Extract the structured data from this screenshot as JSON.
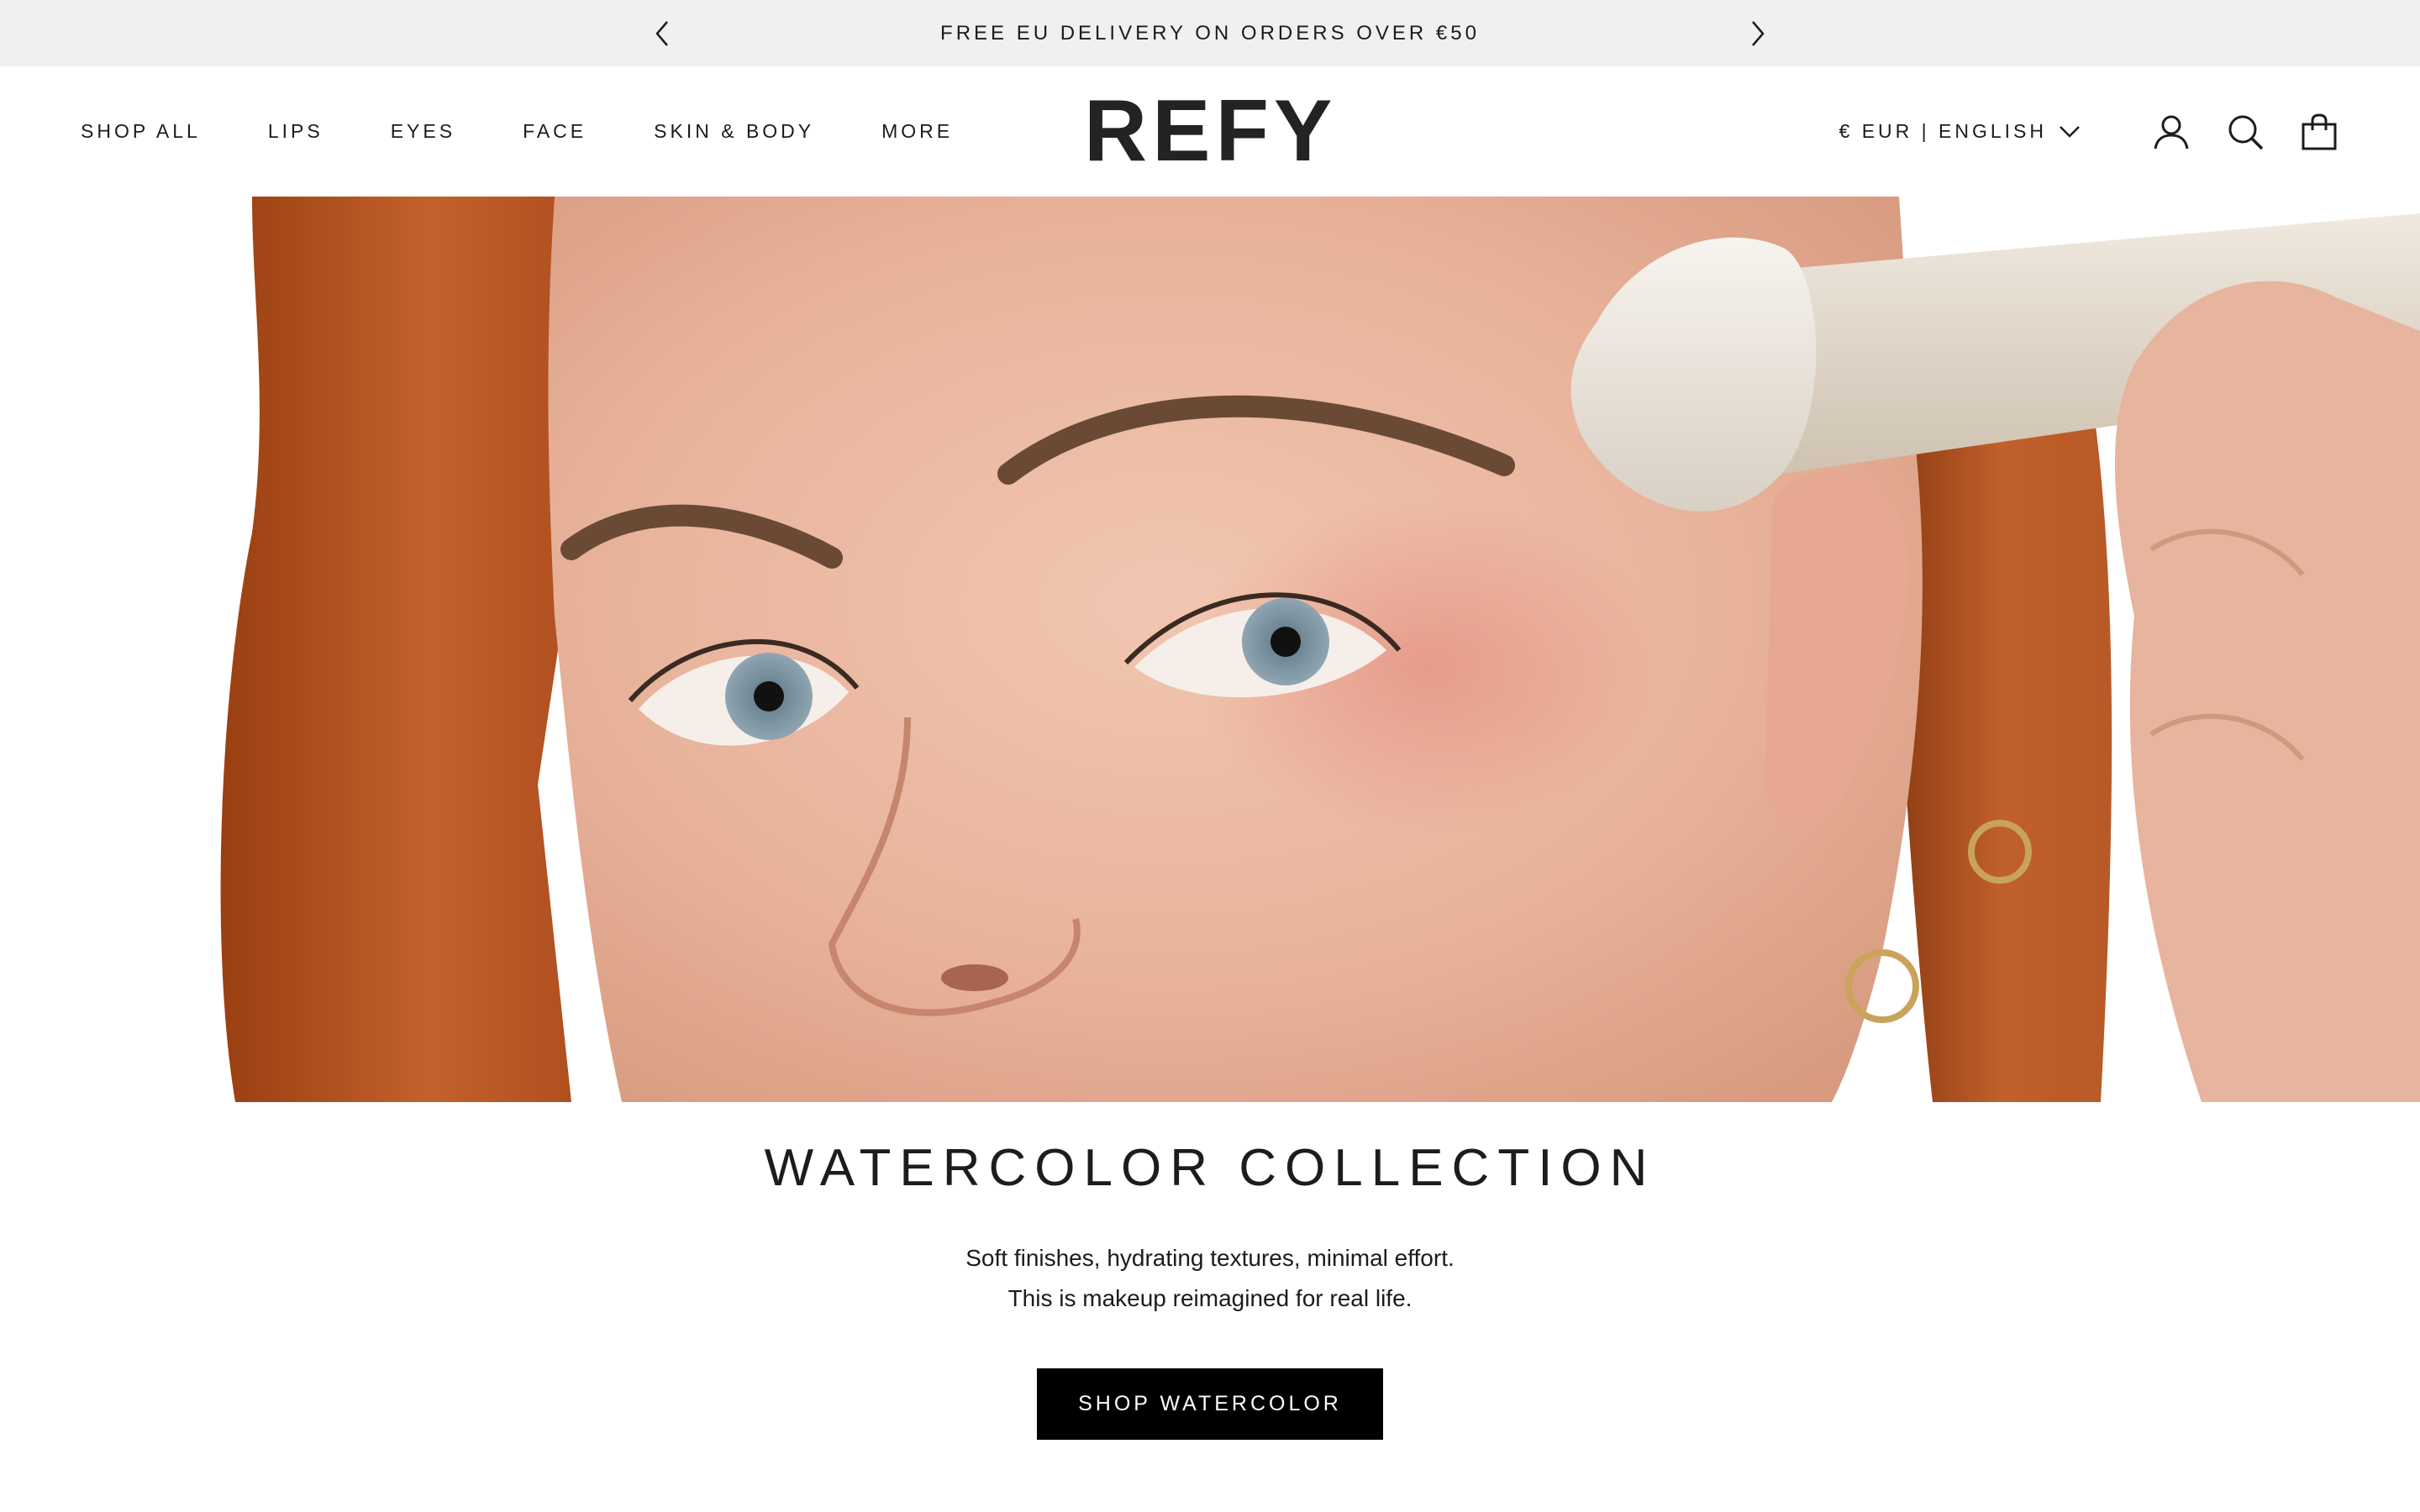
{
  "announcement": {
    "text": "FREE EU DELIVERY ON ORDERS OVER €50"
  },
  "nav": {
    "items": [
      {
        "label": "SHOP ALL"
      },
      {
        "label": "LIPS"
      },
      {
        "label": "EYES"
      },
      {
        "label": "FACE"
      },
      {
        "label": "SKIN & BODY"
      },
      {
        "label": "MORE"
      }
    ]
  },
  "brand": {
    "logo": "REFY"
  },
  "header": {
    "locale": "€ EUR | ENGLISH",
    "icons": [
      "account-icon",
      "search-icon",
      "cart-icon"
    ]
  },
  "hero": {
    "image": "close-up portrait of a red-haired model applying makeup with a brush",
    "colors": {
      "hair": "#b5531f",
      "skin": "#e9b8a2",
      "brush": "#f3efe9"
    }
  },
  "collection": {
    "title": "WATERCOLOR COLLECTION",
    "line1": "Soft finishes, hydrating textures, minimal effort.",
    "line2": "This is makeup reimagined for real life.",
    "cta": "SHOP WATERCOLOR"
  },
  "colors": {
    "announcement_bg": "#f0f0f0",
    "text": "#1c1c1c",
    "button_bg": "#000000",
    "button_text": "#ffffff"
  }
}
